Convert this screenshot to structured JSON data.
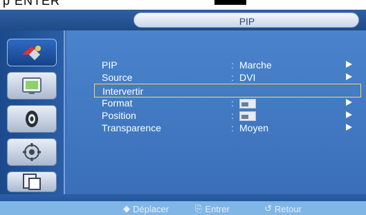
{
  "top_fragment_text": "p ENTER",
  "osd": {
    "title": "PIP",
    "sidebar": [
      {
        "name": "input-icon",
        "active": true
      },
      {
        "name": "picture-icon",
        "active": false
      },
      {
        "name": "sound-icon",
        "active": false
      },
      {
        "name": "setup-icon",
        "active": false
      },
      {
        "name": "multi-window-icon",
        "active": false
      }
    ],
    "menu": [
      {
        "label": "PIP",
        "value": "Marche",
        "arrow": true
      },
      {
        "label": "Source",
        "value": "DVI",
        "arrow": true
      },
      {
        "label": "Intervertir",
        "value": "",
        "arrow": false,
        "selected": true
      },
      {
        "label": "Format",
        "value": "",
        "arrow": true,
        "swatch": true
      },
      {
        "label": "Position",
        "value": "",
        "arrow": true,
        "swatch": true
      },
      {
        "label": "Transparence",
        "value": "Moyen",
        "arrow": true
      }
    ],
    "hints": {
      "move": "Déplacer",
      "enter": "Entrer",
      "return": "Retour"
    },
    "colors": {
      "panel": "#3a6fb8",
      "highlight_border": "#ffd84a",
      "bottom_strip": "#7fb6e6"
    }
  }
}
